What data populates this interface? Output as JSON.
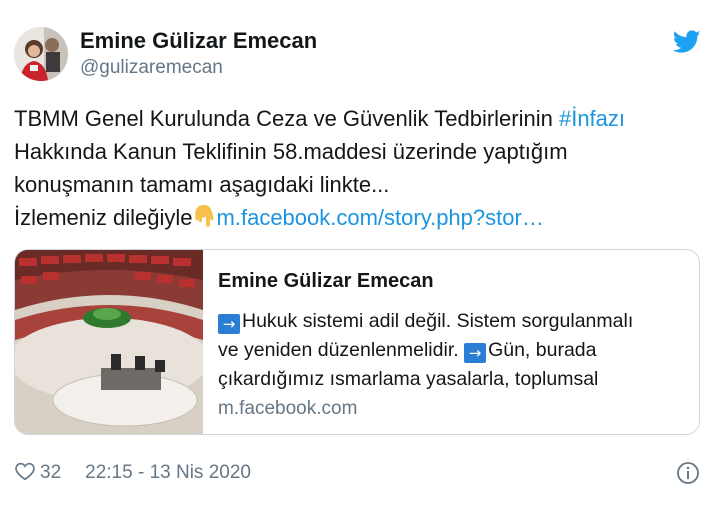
{
  "author": {
    "name": "Emine Gülizar Emecan",
    "handle": "@gulizaremecan"
  },
  "tweet": {
    "line1_text": "TBMM Genel Kurulunda Ceza ve Güvenlik Tedbirlerinin ",
    "hashtag": "#İnfazı",
    "line2": " Hakkında Kanun Teklifinin 58.maddesi üzerinde yaptığım",
    "line3": "konuşmanın tamamı aşagıdaki linkte...",
    "line4_text": "İzlemeniz dileğiyle",
    "link": "m.facebook.com/story.php?stor…"
  },
  "card": {
    "title": "Emine Gülizar Emecan",
    "desc_line1": "Hukuk sistemi adil değil. Sistem sorgulanmalı",
    "desc_line2a": "ve yeniden düzenlenmelidir. ",
    "desc_line2b": "Gün, burada",
    "desc_line3": "çıkardığımız ısmarlama yasalarla, toplumsal",
    "domain": "m.facebook.com",
    "arrow_glyph": "→"
  },
  "footer": {
    "like_count": "32",
    "timestamp": "22:15 - 13 Nis 2020"
  },
  "colors": {
    "link": "#1b95e0",
    "twitter_blue": "#1da1f2",
    "secondary_text": "#657786",
    "border": "#ccd6dd"
  },
  "icons": [
    "twitter-bird-icon",
    "pointing-down-emoji-icon",
    "arrow-right-box-icon",
    "heart-icon",
    "info-icon"
  ]
}
